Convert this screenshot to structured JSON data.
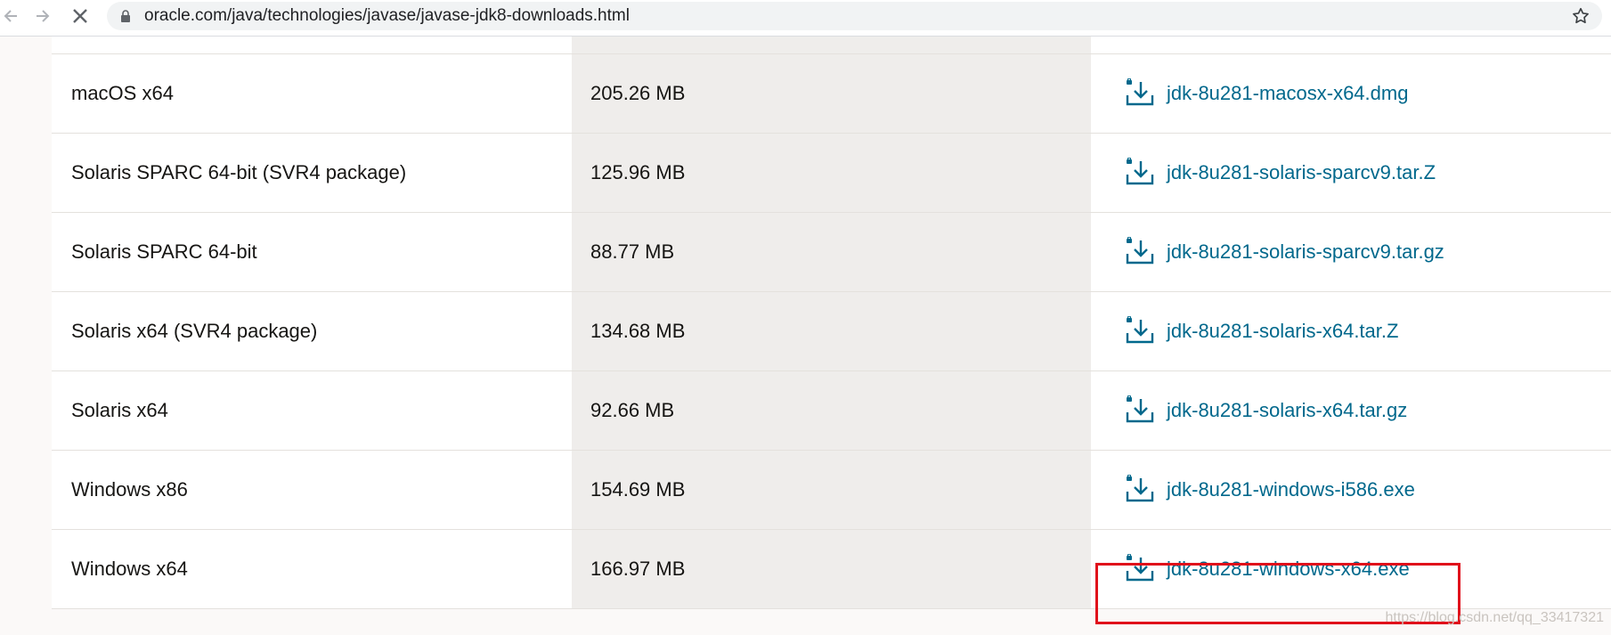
{
  "browser": {
    "url": "oracle.com/java/technologies/javase/javase-jdk8-downloads.html"
  },
  "downloads": [
    {
      "os": "macOS x64",
      "size": "205.26 MB",
      "file": "jdk-8u281-macosx-x64.dmg"
    },
    {
      "os": "Solaris SPARC 64-bit (SVR4 package)",
      "size": "125.96 MB",
      "file": "jdk-8u281-solaris-sparcv9.tar.Z"
    },
    {
      "os": "Solaris SPARC 64-bit",
      "size": "88.77 MB",
      "file": "jdk-8u281-solaris-sparcv9.tar.gz"
    },
    {
      "os": "Solaris x64 (SVR4 package)",
      "size": "134.68 MB",
      "file": "jdk-8u281-solaris-x64.tar.Z"
    },
    {
      "os": "Solaris x64",
      "size": "92.66 MB",
      "file": "jdk-8u281-solaris-x64.tar.gz"
    },
    {
      "os": "Windows x86",
      "size": "154.69 MB",
      "file": "jdk-8u281-windows-i586.exe"
    },
    {
      "os": "Windows x64",
      "size": "166.97 MB",
      "file": "jdk-8u281-windows-x64.exe"
    }
  ],
  "icons": {
    "back": "arrow-left-icon",
    "forward": "arrow-right-icon",
    "stop": "close-icon",
    "secure": "lock-icon",
    "bookmark": "star-icon",
    "download": "download-icon"
  },
  "colors": {
    "link": "#00688c",
    "highlight": "#e0101b"
  },
  "watermark": "https://blog.csdn.net/qq_33417321"
}
